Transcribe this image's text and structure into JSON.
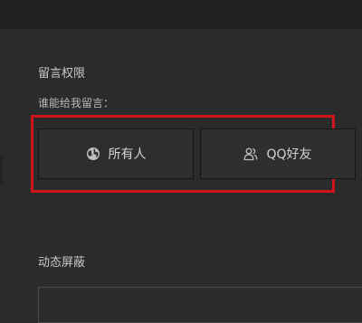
{
  "message_permission": {
    "title": "留言权限",
    "prompt": "谁能给我留言：",
    "options": [
      {
        "label": "所有人",
        "icon": "globe-icon"
      },
      {
        "label": "QQ好友",
        "icon": "friends-icon"
      }
    ]
  },
  "dynamic_block": {
    "title": "动态屏蔽"
  },
  "colors": {
    "highlight": "#d01419",
    "background": "#2b2b2b"
  }
}
